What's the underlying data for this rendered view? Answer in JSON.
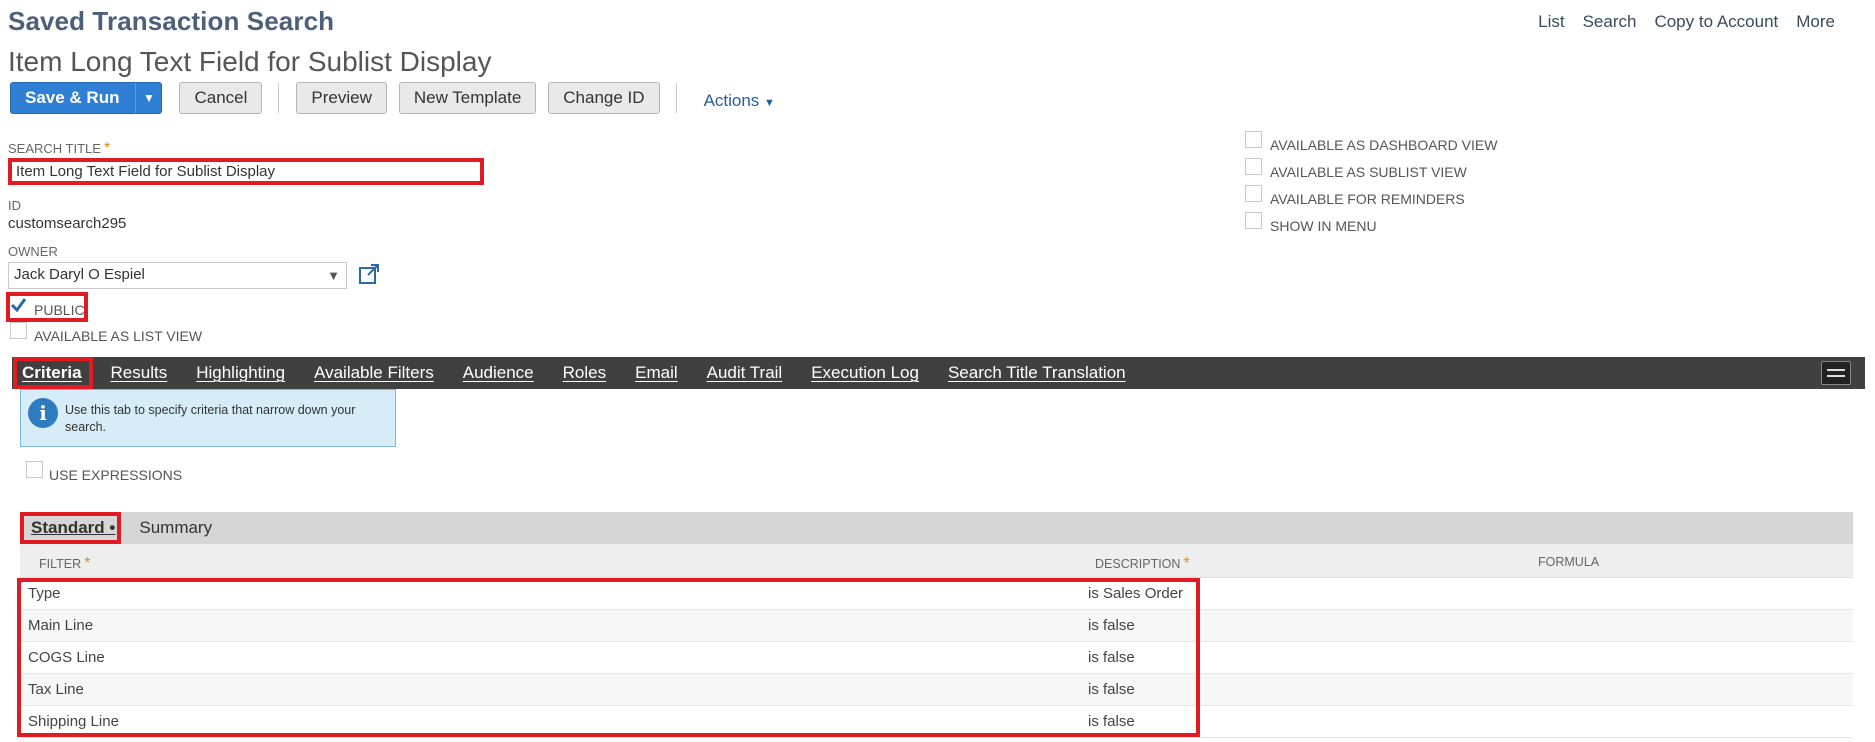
{
  "header": {
    "page_title": "Saved Transaction Search",
    "record_title": "Item Long Text Field for Sublist Display",
    "links": [
      "List",
      "Search",
      "Copy to Account",
      "More"
    ]
  },
  "toolbar": {
    "save_run": "Save & Run",
    "cancel": "Cancel",
    "preview": "Preview",
    "new_template": "New Template",
    "change_id": "Change ID",
    "actions": "Actions"
  },
  "form": {
    "search_title_label": "SEARCH TITLE",
    "search_title_value": "Item Long Text Field for Sublist Display",
    "id_label": "ID",
    "id_value": "customsearch295",
    "owner_label": "OWNER",
    "owner_value": "Jack Daryl O Espiel",
    "public_label": "PUBLIC",
    "public_checked": true,
    "list_view_label": "AVAILABLE AS LIST VIEW"
  },
  "options": [
    "AVAILABLE AS DASHBOARD VIEW",
    "AVAILABLE AS SUBLIST VIEW",
    "AVAILABLE FOR REMINDERS",
    "SHOW IN MENU"
  ],
  "tabs": [
    "Criteria",
    "Results",
    "Highlighting",
    "Available Filters",
    "Audience",
    "Roles",
    "Email",
    "Audit Trail",
    "Execution Log",
    "Search Title Translation"
  ],
  "criteria": {
    "info_text": "Use this tab to specify criteria that narrow down your search.",
    "use_expressions": "USE EXPRESSIONS",
    "subtabs": {
      "standard": "Standard •",
      "summary": "Summary"
    },
    "columns": {
      "filter": "FILTER",
      "description": "DESCRIPTION",
      "formula": "FORMULA"
    },
    "rows": [
      {
        "filter": "Type",
        "description": "is Sales Order"
      },
      {
        "filter": "Main Line",
        "description": "is false"
      },
      {
        "filter": "COGS Line",
        "description": "is false"
      },
      {
        "filter": "Tax Line",
        "description": "is false"
      },
      {
        "filter": "Shipping Line",
        "description": "is false"
      }
    ]
  },
  "colors": {
    "primary": "#2f7fd4",
    "highlight": "#e21b23",
    "tabbar": "#404040",
    "title": "#4d5f79"
  }
}
